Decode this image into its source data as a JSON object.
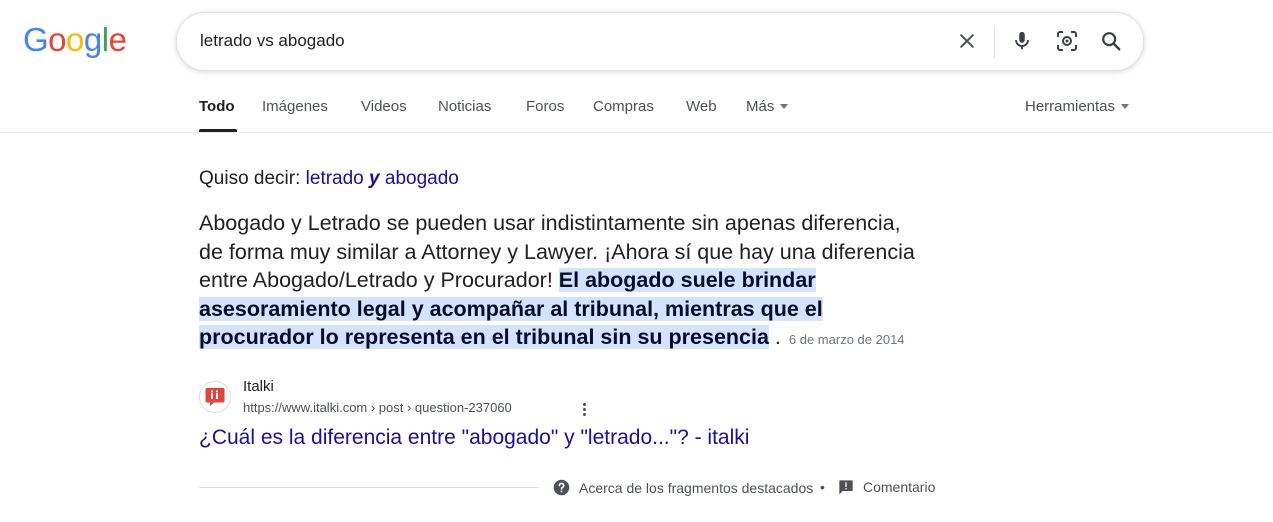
{
  "logo": {
    "letters": [
      "G",
      "o",
      "o",
      "g",
      "l",
      "e"
    ],
    "colors": [
      "#4285F4",
      "#EA4335",
      "#FBBC05",
      "#4285F4",
      "#34A853",
      "#EA4335"
    ]
  },
  "search": {
    "value": "letrado vs abogado",
    "icons": [
      "close-icon",
      "mic-icon",
      "lens-icon",
      "search-icon"
    ]
  },
  "tabs": [
    {
      "label": "Todo",
      "active": true
    },
    {
      "label": "Imágenes"
    },
    {
      "label": "Videos"
    },
    {
      "label": "Noticias"
    },
    {
      "label": "Foros"
    },
    {
      "label": "Compras"
    },
    {
      "label": "Web"
    },
    {
      "label": "Más"
    }
  ],
  "tools_label": "Herramientas",
  "did_you_mean": {
    "prefix": "Quiso decir:",
    "part1": "letrado",
    "emph": "y",
    "part2": "abogado"
  },
  "snippet": {
    "text_plain": "Abogado y Letrado se pueden usar indistintamente sin apenas diferencia, de forma muy similar a Attorney y Lawyer. ¡Ahora sí que hay una diferencia entre Abogado/Letrado y Procurador!",
    "text_highlight": "El abogado suele brindar asesoramiento legal y acompañar al tribunal, mientras que el procurador lo representa en el tribunal sin su presencia",
    "text_end": ".",
    "date": "6 de marzo de 2014"
  },
  "source": {
    "site_name": "Italki",
    "url": "https://www.italki.com › post › question-237060",
    "title": "¿Cuál es la diferencia entre \"abogado\" y \"letrado...\"? - italki"
  },
  "footer": {
    "about": "Acerca de los fragmentos destacados",
    "separator": "•",
    "feedback": "Comentario"
  },
  "colors": {
    "link": "#1a0dab",
    "highlight": "#d3e3fd",
    "italki_red": "#e2453c"
  }
}
